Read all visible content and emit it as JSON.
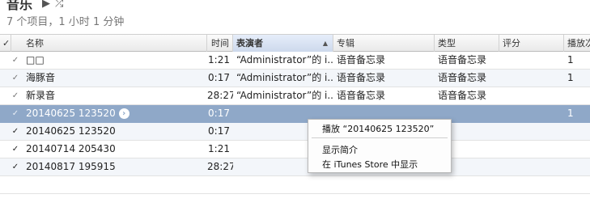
{
  "header": {
    "title": "音乐",
    "play_icon": "play-icon",
    "shuffle_icon": "shuffle-icon",
    "subtitle": "7 个项目，1 小时 1 分钟"
  },
  "columns": {
    "check": "✓",
    "name": "名称",
    "time": "时间",
    "artist": "表演者",
    "album": "专辑",
    "genre": "类型",
    "rating": "评分",
    "plays": "播放次"
  },
  "sort_indicator": "▲",
  "rows": [
    {
      "check": "✓",
      "name": "□□",
      "time": "1:21",
      "artist": "“Administrator”的 i...",
      "album": "语音备忘录",
      "genre": "语音备忘录",
      "rating": "",
      "plays": "1"
    },
    {
      "check": "✓",
      "name": "海豚音",
      "time": "0:17",
      "artist": "“Administrator”的 i...",
      "album": "语音备忘录",
      "genre": "语音备忘录",
      "rating": "",
      "plays": "1"
    },
    {
      "check": "✓",
      "name": "新录音",
      "time": "28:27",
      "artist": "“Administrator”的 i...",
      "album": "语音备忘录",
      "genre": "语音备忘录",
      "rating": "",
      "plays": ""
    },
    {
      "check": "✓",
      "name": "20140625 123520",
      "time": "0:17",
      "artist": "",
      "album": "",
      "genre": "",
      "rating": "",
      "plays": "1"
    },
    {
      "check": "✓",
      "name": "20140625 123520",
      "time": "0:17",
      "artist": "",
      "album": "",
      "genre": "",
      "rating": "",
      "plays": ""
    },
    {
      "check": "✓",
      "name": "20140714 205430",
      "time": "1:21",
      "artist": "",
      "album": "",
      "genre": "",
      "rating": "",
      "plays": ""
    },
    {
      "check": "✓",
      "name": "20140817 195915",
      "time": "28:27",
      "artist": "",
      "album": "",
      "genre": "",
      "rating": "",
      "plays": ""
    }
  ],
  "selected_row_arrow": "›",
  "context_menu": {
    "play": "播放 “20140625 123520”",
    "show_info": "显示简介",
    "show_in_store": "在 iTunes Store 中显示"
  }
}
